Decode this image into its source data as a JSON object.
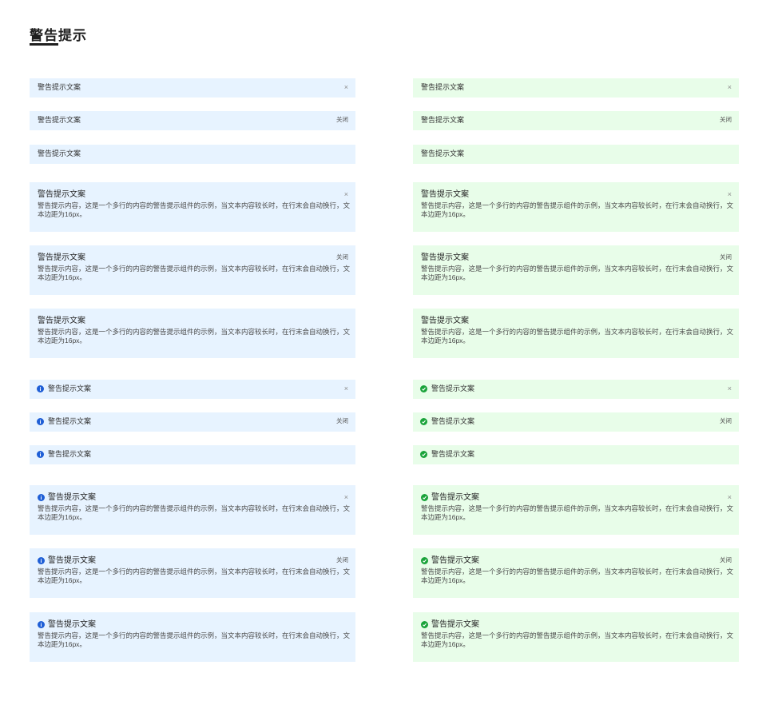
{
  "page": {
    "title": "警告提示"
  },
  "colors": {
    "info_background": "#e7f3ff",
    "info_icon": "#1f5fd6",
    "success_background": "#e8fde9",
    "success_icon": "#1aa33a",
    "title_underline": "#1f1f1f"
  },
  "icons": {
    "info": "info-icon",
    "success": "check-circle-icon",
    "close": "close-icon"
  },
  "alert": {
    "title": "警告提示文案",
    "description": "警告提示内容，这是一个多行的内容的警告提示组件的示例，当文本内容较长时，在行末会自动换行，文本边距为16px。",
    "close_symbol": "×",
    "close_text": "关闭"
  }
}
